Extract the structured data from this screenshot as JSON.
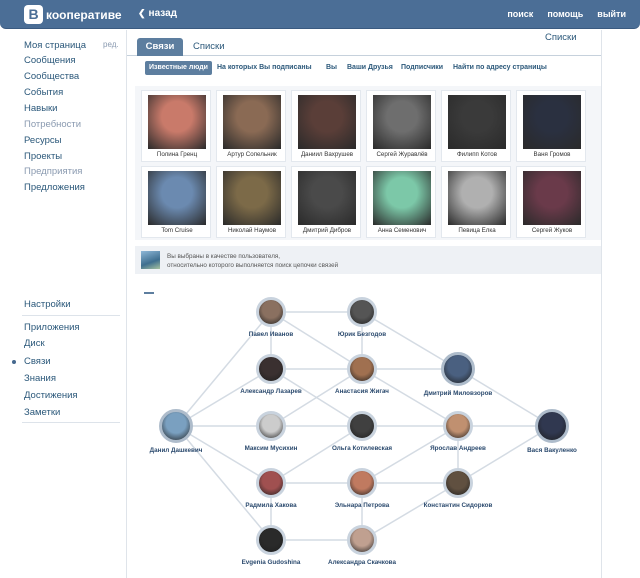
{
  "header": {
    "logo_letter": "В",
    "logo_text": "кооперативе",
    "back_label": "назад",
    "nav": [
      "поиск",
      "помощь",
      "выйти"
    ]
  },
  "sidebar": {
    "edit_label": "ред.",
    "items_top": [
      {
        "label": "Моя страница",
        "muted": false
      },
      {
        "label": "Сообщения",
        "muted": false
      },
      {
        "label": "Сообщества",
        "muted": false
      },
      {
        "label": "События",
        "muted": false
      },
      {
        "label": "Навыки",
        "muted": false
      },
      {
        "label": "Потребности",
        "muted": true
      },
      {
        "label": "Ресурсы",
        "muted": false
      },
      {
        "label": "Проекты",
        "muted": false
      },
      {
        "label": "Предприятия",
        "muted": true
      },
      {
        "label": "Предложения",
        "muted": false
      }
    ],
    "items_bottom": [
      {
        "label": "Настройки"
      },
      {
        "label": "Приложения"
      },
      {
        "label": "Диск"
      },
      {
        "label": "Связи"
      },
      {
        "label": "Знания"
      },
      {
        "label": "Достижения"
      },
      {
        "label": "Заметки"
      }
    ]
  },
  "tabs": {
    "active": "Связи",
    "inactive": "Списки",
    "right_link": "Списки"
  },
  "subtabs": [
    "Известные люди",
    "На которых Вы подписаны",
    "Вы",
    "Ваши Друзья",
    "Подписчики",
    "Найти по адресу страницы"
  ],
  "people": [
    {
      "name": "Полина Гренц",
      "color": "#c97a6a"
    },
    {
      "name": "Артур Сопельник",
      "color": "#8a6a54"
    },
    {
      "name": "Даниил Вахрушев",
      "color": "#5a3e38"
    },
    {
      "name": "Сергей Журавлёв",
      "color": "#6e6e6e"
    },
    {
      "name": "Филипп Котов",
      "color": "#3a3a3a"
    },
    {
      "name": "Ваня Громов",
      "color": "#2a3040"
    },
    {
      "name": "Tom Cruise",
      "color": "#6b8ab0"
    },
    {
      "name": "Николай Наумов",
      "color": "#7c6a48"
    },
    {
      "name": "Дмитрий Дибров",
      "color": "#4a4a4a"
    },
    {
      "name": "Анна Семенович",
      "color": "#7cc8a8"
    },
    {
      "name": "Певица Ёлка",
      "color": "#b0b0b0"
    },
    {
      "name": "Сергей Жуков",
      "color": "#6a3a4a"
    }
  ],
  "info": {
    "line1": "Вы выбраны в качестве пользователя,",
    "line2": "относительно которого выполняется поиск цепочки связей"
  },
  "graph": {
    "nodes": [
      {
        "id": "pavel",
        "name": "Павел Иванов",
        "color": "#8a7060"
      },
      {
        "id": "yurik",
        "name": "Юрик Безгодов",
        "color": "#555555"
      },
      {
        "id": "alexlaz",
        "name": "Александр Лазарев",
        "color": "#3a3030"
      },
      {
        "id": "anastasia",
        "name": "Анастасия Жигач",
        "color": "#a07050"
      },
      {
        "id": "dmitry",
        "name": "Дмитрий Миловзоров",
        "color": "#4a6080"
      },
      {
        "id": "danil",
        "name": "Данил Дашкевич",
        "color": "#7aa0c0"
      },
      {
        "id": "maxim",
        "name": "Максим Мусихин",
        "color": "#cccccc"
      },
      {
        "id": "olga",
        "name": "Ольга Котилевская",
        "color": "#404040"
      },
      {
        "id": "yaroslav",
        "name": "Ярослав Андреев",
        "color": "#c09070"
      },
      {
        "id": "vasya",
        "name": "Вася Вакуленко",
        "color": "#303850"
      },
      {
        "id": "radmila",
        "name": "Радмила Хакова",
        "color": "#a05050"
      },
      {
        "id": "elnara",
        "name": "Эльнара Петрова",
        "color": "#c07a60"
      },
      {
        "id": "konstantin",
        "name": "Константин Сидорков",
        "color": "#605040"
      },
      {
        "id": "evgenia",
        "name": "Evgenia Gudoshina",
        "color": "#2a2a2a"
      },
      {
        "id": "alexskach",
        "name": "Александра Скачкова",
        "color": "#c0a090"
      }
    ],
    "edges": [
      [
        "pavel",
        "yurik"
      ],
      [
        "pavel",
        "alexlaz"
      ],
      [
        "pavel",
        "danil"
      ],
      [
        "pavel",
        "anastasia"
      ],
      [
        "yurik",
        "anastasia"
      ],
      [
        "yurik",
        "dmitry"
      ],
      [
        "alexlaz",
        "anastasia"
      ],
      [
        "alexlaz",
        "olga"
      ],
      [
        "alexlaz",
        "danil"
      ],
      [
        "anastasia",
        "dmitry"
      ],
      [
        "anastasia",
        "yaroslav"
      ],
      [
        "anastasia",
        "maxim"
      ],
      [
        "dmitry",
        "vasya"
      ],
      [
        "danil",
        "maxim"
      ],
      [
        "danil",
        "radmila"
      ],
      [
        "danil",
        "evgenia"
      ],
      [
        "maxim",
        "olga"
      ],
      [
        "olga",
        "yaroslav"
      ],
      [
        "olga",
        "radmila"
      ],
      [
        "yaroslav",
        "vasya"
      ],
      [
        "yaroslav",
        "konstantin"
      ],
      [
        "yaroslav",
        "elnara"
      ],
      [
        "radmila",
        "elnara"
      ],
      [
        "elnara",
        "konstantin"
      ],
      [
        "konstantin",
        "vasya"
      ],
      [
        "radmila",
        "evgenia"
      ],
      [
        "evgenia",
        "alexskach"
      ],
      [
        "elnara",
        "alexskach"
      ],
      [
        "konstantin",
        "alexskach"
      ]
    ]
  }
}
